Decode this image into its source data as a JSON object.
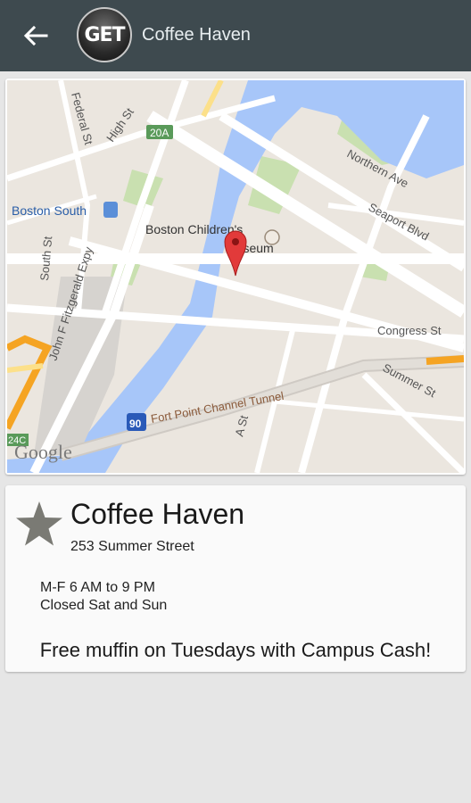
{
  "appbar": {
    "title": "Coffee Haven",
    "logo_text": "GET",
    "back_icon": "arrow-left-icon",
    "background": "#3e4a4f"
  },
  "map": {
    "streets": {
      "federal": "Federal St",
      "high": "High St",
      "route20a": "20A",
      "northern": "Northern Ave",
      "seaport": "Seaport Blvd",
      "boston_south": "Boston South",
      "south": "South St",
      "fitzgerald": "John F Fitzgerald Expy",
      "museum_line1": "Boston Children's",
      "museum_line2": "Museum",
      "congress": "Congress St",
      "summer": "Summer St",
      "tunnel": "Fort Point Channel Tunnel",
      "a_st": "A St",
      "route90": "90",
      "route24c": "24C"
    },
    "attribution": "Google",
    "marker_icon": "map-pin-icon",
    "water_color": "#a7c6f9",
    "land_color": "#ebe6df"
  },
  "place": {
    "name": "Coffee Haven",
    "address": "253 Summer Street",
    "hours_weekday": "M-F 6 AM to 9 PM",
    "hours_weekend": "Closed Sat and Sun",
    "promo": "Free muffin on Tuesdays with Campus Cash!",
    "favorite_icon": "star-icon"
  }
}
